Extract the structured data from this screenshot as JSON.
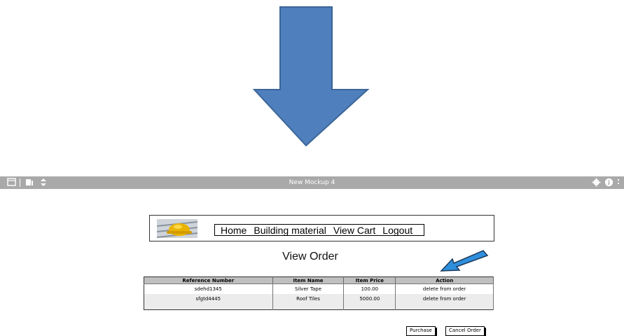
{
  "toolbar": {
    "title": "New Mockup 4",
    "left_icons": [
      "window-icon",
      "pages-icon",
      "sort-arrows-icon"
    ],
    "right_icons": [
      "gear-icon",
      "info-icon"
    ]
  },
  "header": {
    "logo": "hardhat-logo",
    "nav": [
      "Home",
      "Building material",
      "View Cart",
      "Logout"
    ]
  },
  "page_title": "View Order",
  "table": {
    "columns": [
      "Reference Number",
      "Item Name",
      "Item Price",
      "Action"
    ],
    "rows": [
      [
        "sdehd1345",
        "Silver Tape",
        "100.00",
        "delete from order"
      ],
      [
        "sfgtd4445",
        "Roof Tiles",
        "5000.00",
        "delete from order"
      ]
    ]
  },
  "buttons": {
    "purchase": "Purchase",
    "cancel": "Cancel Order"
  },
  "colors": {
    "big_arrow": "#4f7fbd",
    "callout_arrow": "#2f8fdc",
    "toolbar": "#a9a9a9"
  }
}
